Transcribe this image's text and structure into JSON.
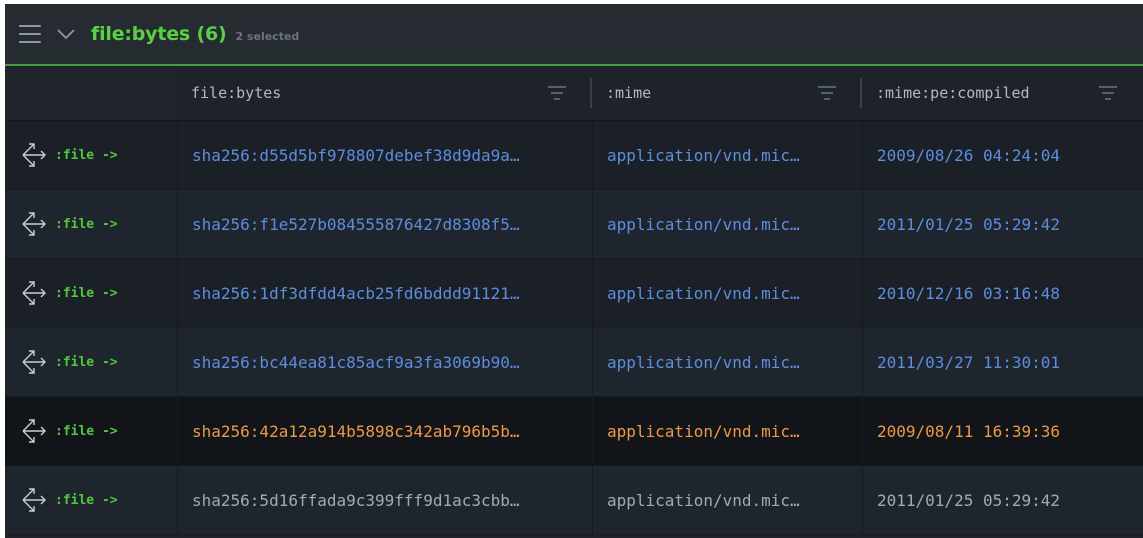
{
  "header": {
    "title": "file:bytes (6)",
    "selected_note": "2 selected"
  },
  "columns": [
    {
      "label": ""
    },
    {
      "label": "file:bytes"
    },
    {
      "label": ":mime"
    },
    {
      "label": ":mime:pe:compiled"
    }
  ],
  "pivot_label": ":file ->",
  "rows": [
    {
      "sha": "sha256:d55d5bf978807debef38d9da9a…",
      "mime": "application/vnd.mic…",
      "compiled": "2009/08/26 04:24:04",
      "state": "normal"
    },
    {
      "sha": "sha256:f1e527b084555876427d8308f5…",
      "mime": "application/vnd.mic…",
      "compiled": "2011/01/25 05:29:42",
      "state": "normal"
    },
    {
      "sha": "sha256:1df3dfdd4acb25fd6bddd91121…",
      "mime": "application/vnd.mic…",
      "compiled": "2010/12/16 03:16:48",
      "state": "normal"
    },
    {
      "sha": "sha256:bc44ea81c85acf9a3fa3069b90…",
      "mime": "application/vnd.mic…",
      "compiled": "2011/03/27 11:30:01",
      "state": "normal"
    },
    {
      "sha": "sha256:42a12a914b5898c342ab796b5b…",
      "mime": "application/vnd.mic…",
      "compiled": "2009/08/11 16:39:36",
      "state": "selected"
    },
    {
      "sha": "sha256:5d16ffada9c399fff9d1ac3cbb…",
      "mime": "application/vnd.mic…",
      "compiled": "2011/01/25 05:29:42",
      "state": "muted"
    }
  ],
  "colors": {
    "accent_green": "#55d23e",
    "link_blue": "#5a8ee0",
    "selected_orange": "#ee9a3a"
  },
  "icons": {
    "menu": "hamburger-icon",
    "collapse": "chevron-down-icon",
    "filter": "filter-icon",
    "pivot": "pivot-arrows-icon"
  }
}
